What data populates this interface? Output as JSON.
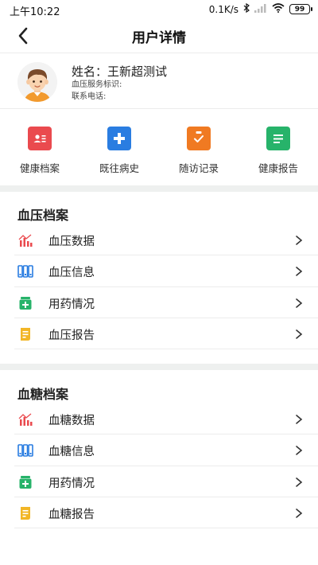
{
  "status": {
    "time": "上午10:22",
    "speed": "0.1K/s",
    "battery": "99"
  },
  "nav": {
    "title": "用户详情"
  },
  "profile": {
    "name_label": "姓名：",
    "name_value": "王新超测试",
    "bp_id_label": "血压服务标识:",
    "phone_label": "联系电话:"
  },
  "quick_menu": [
    {
      "label": "健康档案",
      "icon": "health-file-icon",
      "color": "#ea4a4e"
    },
    {
      "label": "既往病史",
      "icon": "medical-history-icon",
      "color": "#2a7de1"
    },
    {
      "label": "随访记录",
      "icon": "followup-record-icon",
      "color": "#f07a22"
    },
    {
      "label": "健康报告",
      "icon": "health-report-icon",
      "color": "#27b36a"
    }
  ],
  "bp_section": {
    "title": "血压档案",
    "items": [
      {
        "label": "血压数据",
        "icon": "bar-chart-icon"
      },
      {
        "label": "血压信息",
        "icon": "info-blocks-icon"
      },
      {
        "label": "用药情况",
        "icon": "medicine-icon"
      },
      {
        "label": "血压报告",
        "icon": "report-scroll-icon"
      }
    ]
  },
  "bg_section": {
    "title": "血糖档案",
    "items": [
      {
        "label": "血糖数据",
        "icon": "bar-chart-icon"
      },
      {
        "label": "血糖信息",
        "icon": "info-blocks-icon"
      },
      {
        "label": "用药情况",
        "icon": "medicine-icon"
      },
      {
        "label": "血糖报告",
        "icon": "report-scroll-icon"
      }
    ]
  },
  "colors": {
    "red": "#ea4a4e",
    "blue": "#2a7de1",
    "orange": "#f07a22",
    "green": "#27b36a",
    "yellow": "#f2b626"
  }
}
